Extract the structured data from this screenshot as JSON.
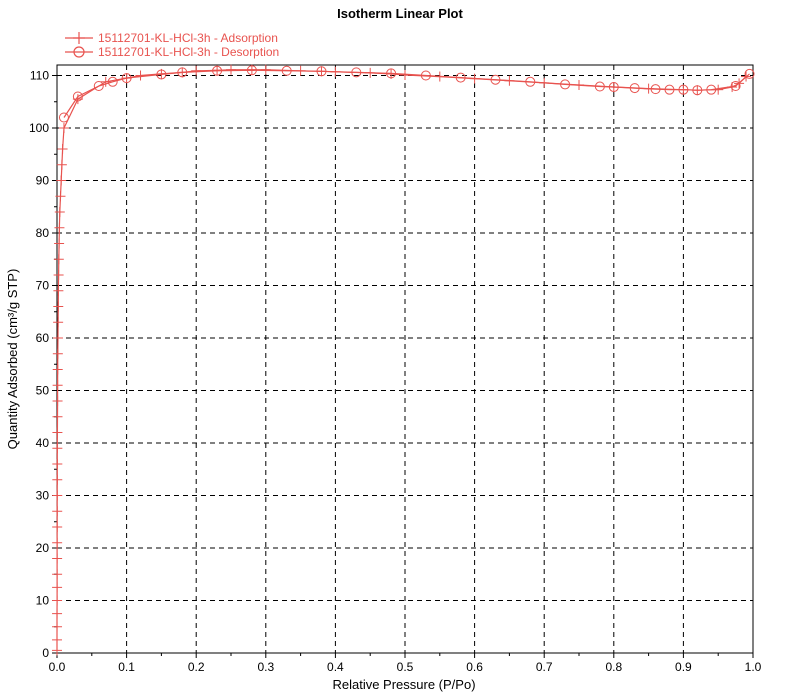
{
  "chart_data": {
    "type": "line",
    "title": "Isotherm Linear Plot",
    "xlabel": "Relative Pressure (P/Po)",
    "ylabel": "Quantity Adsorbed (cm³/g STP)",
    "xlim": [
      0,
      1.0
    ],
    "ylim": [
      0,
      112
    ],
    "x_ticks": [
      "0.0",
      "0.1",
      "0.2",
      "0.3",
      "0.4",
      "0.5",
      "0.6",
      "0.7",
      "0.8",
      "0.9",
      "1.0"
    ],
    "y_ticks": [
      "0",
      "10",
      "20",
      "30",
      "40",
      "50",
      "60",
      "70",
      "80",
      "90",
      "100",
      "110"
    ],
    "grid": true,
    "legend_position": "top-left",
    "line_color": "#e8534f",
    "series": [
      {
        "name": "15112701-KL-HCl-3h - Adsorption",
        "marker": "plus",
        "x": [
          0.0,
          2e-05,
          4e-05,
          6e-05,
          8e-05,
          0.0001,
          0.00013,
          0.00016,
          0.0002,
          0.00025,
          0.0003,
          0.00035,
          0.0004,
          0.00045,
          0.0005,
          0.0006,
          0.0007,
          0.0008,
          0.0009,
          0.001,
          0.0012,
          0.0014,
          0.0016,
          0.0018,
          0.002,
          0.0023,
          0.0026,
          0.003,
          0.0035,
          0.004,
          0.005,
          0.006,
          0.007,
          0.008,
          0.01,
          0.03,
          0.07,
          0.1,
          0.12,
          0.15,
          0.18,
          0.2,
          0.23,
          0.25,
          0.28,
          0.3,
          0.35,
          0.38,
          0.4,
          0.45,
          0.48,
          0.5,
          0.55,
          0.6,
          0.65,
          0.7,
          0.75,
          0.8,
          0.85,
          0.9,
          0.92,
          0.95,
          0.97,
          0.98,
          0.99
        ],
        "y": [
          0.5,
          2.5,
          5.0,
          7.5,
          10.0,
          12.5,
          15.0,
          18.0,
          21.0,
          24.0,
          27.0,
          30.0,
          33.0,
          36.0,
          39.0,
          42.0,
          45.0,
          48.0,
          51.0,
          54.0,
          57.0,
          60.0,
          63.0,
          66.0,
          69.0,
          72.0,
          75.0,
          78.0,
          81.0,
          84.0,
          87.0,
          90.0,
          93.0,
          96.0,
          100.0,
          105.5,
          108.8,
          109.5,
          110.0,
          110.3,
          110.6,
          110.9,
          111.0,
          111.1,
          111.1,
          111.1,
          110.9,
          110.8,
          110.7,
          110.5,
          110.3,
          110.1,
          109.8,
          109.4,
          109.0,
          108.6,
          108.2,
          107.8,
          107.5,
          107.3,
          107.2,
          107.3,
          107.8,
          108.5,
          109.8
        ]
      },
      {
        "name": "15112701-KL-HCl-3h - Desorption",
        "marker": "circle",
        "x": [
          0.995,
          0.975,
          0.94,
          0.92,
          0.9,
          0.88,
          0.86,
          0.83,
          0.8,
          0.78,
          0.73,
          0.68,
          0.63,
          0.58,
          0.53,
          0.48,
          0.43,
          0.38,
          0.33,
          0.28,
          0.23,
          0.18,
          0.15,
          0.1,
          0.08,
          0.06,
          0.03,
          0.01
        ],
        "y": [
          110.3,
          108.0,
          107.3,
          107.2,
          107.3,
          107.3,
          107.4,
          107.6,
          107.8,
          107.9,
          108.3,
          108.8,
          109.2,
          109.6,
          110.0,
          110.4,
          110.6,
          110.8,
          110.9,
          111.0,
          110.9,
          110.6,
          110.2,
          109.5,
          108.8,
          108.0,
          106.0,
          102.0
        ]
      }
    ]
  }
}
